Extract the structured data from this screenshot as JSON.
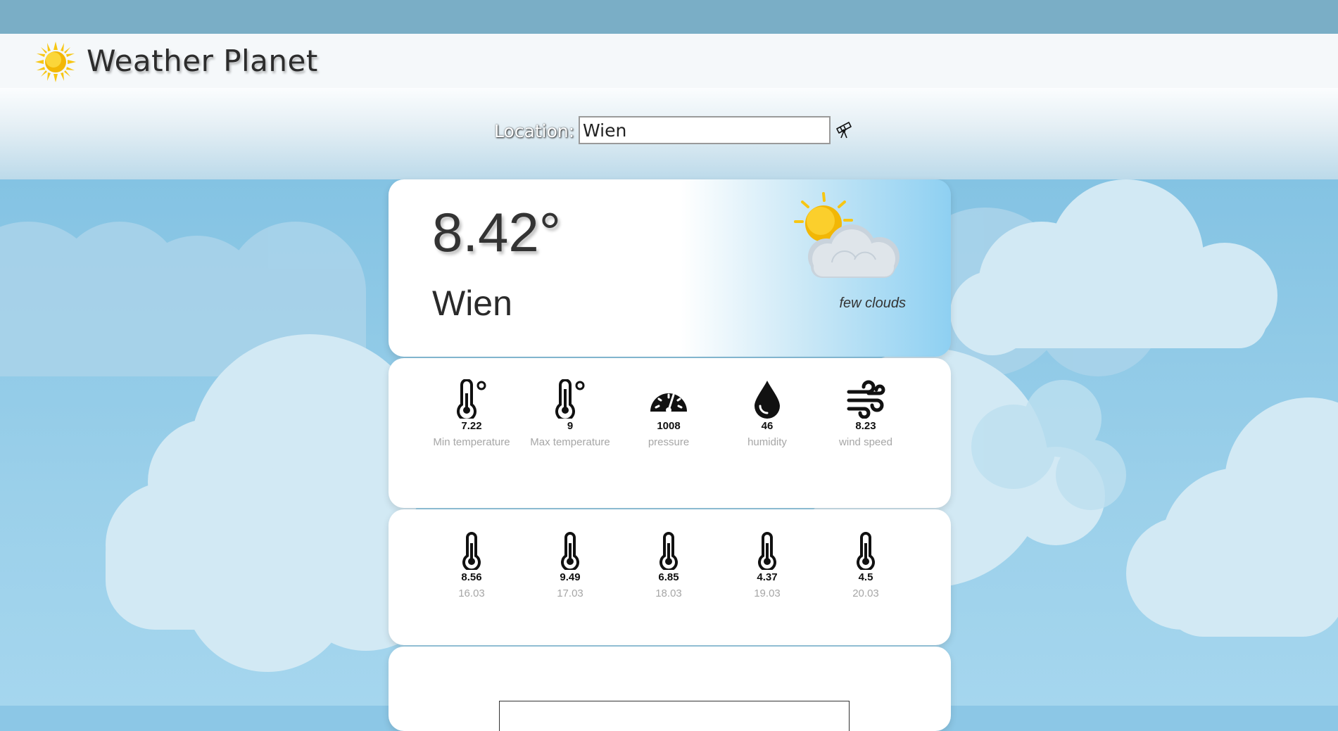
{
  "app": {
    "title": "Weather Planet"
  },
  "search": {
    "label": "Location:",
    "value": "Wien"
  },
  "current": {
    "temperature": "8.42°",
    "city": "Wien",
    "condition": "few clouds"
  },
  "details": [
    {
      "icon": "thermometer-icon",
      "value": "7.22",
      "label": "Min temperature"
    },
    {
      "icon": "thermometer-icon",
      "value": "9",
      "label": "Max temperature"
    },
    {
      "icon": "gauge-icon",
      "value": "1008",
      "label": "pressure"
    },
    {
      "icon": "drop-icon",
      "value": "46",
      "label": "humidity"
    },
    {
      "icon": "wind-icon",
      "value": "8.23",
      "label": "wind speed"
    }
  ],
  "forecast": [
    {
      "value": "8.56",
      "date": "16.03"
    },
    {
      "value": "9.49",
      "date": "17.03"
    },
    {
      "value": "6.85",
      "date": "18.03"
    },
    {
      "value": "4.37",
      "date": "19.03"
    },
    {
      "value": "4.5",
      "date": "20.03"
    }
  ],
  "colors": {
    "sky": "#8cc7e6",
    "header": "#f5f8fa",
    "topbar": "#7aaec6",
    "sun": "#f7c613"
  }
}
